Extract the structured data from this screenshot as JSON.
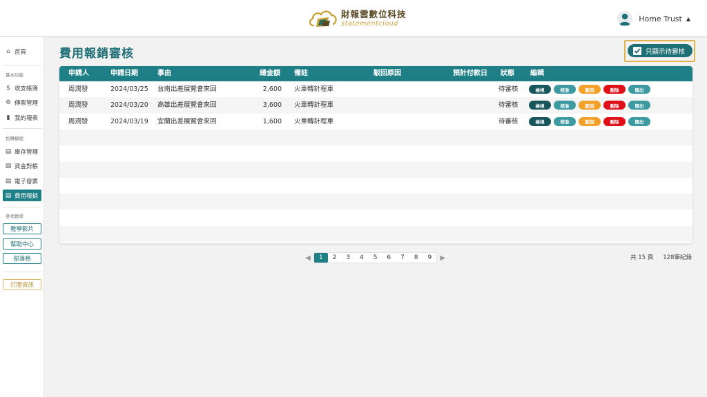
{
  "header": {
    "brand_cn": "財報雲數位科技",
    "brand_en": "statementcloud",
    "user_name": "Home Trust",
    "caret": "▲"
  },
  "sidebar": {
    "home": "首頁",
    "section_basic": "基本功能",
    "basic_items": [
      "收支帳簿",
      "傳票管理",
      "我的報表"
    ],
    "section_addon": "加購模組",
    "addon_items": [
      "庫存管理",
      "資金對帳",
      "電子發票",
      "費用報銷"
    ],
    "section_ref": "參考教學",
    "ref_buttons": [
      "教學影片",
      "幫助中心",
      "部落格"
    ],
    "subscribe": "訂閱資訊"
  },
  "page": {
    "title": "費用報銷審核",
    "filter_label": "只顯示待審核"
  },
  "table": {
    "headers": [
      "申請人",
      "申請日期",
      "事由",
      "總金額",
      "備註",
      "駁回原因",
      "預計付款日",
      "狀態",
      "編輯"
    ],
    "rows": [
      {
        "applicant": "周潤發",
        "date": "2024/03/25",
        "reason": "台南出差展覽會來回",
        "amount": "2,600",
        "note": "火車轉計程車",
        "reject_reason": "",
        "pay_date": "",
        "status": "待審核"
      },
      {
        "applicant": "周潤發",
        "date": "2024/03/20",
        "reason": "高雄出差展覽會來回",
        "amount": "3,600",
        "note": "火車轉計程車",
        "reject_reason": "",
        "pay_date": "",
        "status": "待審核"
      },
      {
        "applicant": "周潤發",
        "date": "2024/03/19",
        "reason": "宜蘭出差展覽會來回",
        "amount": "1,600",
        "note": "火車轉計程車",
        "reject_reason": "",
        "pay_date": "",
        "status": "待審核"
      }
    ],
    "action_labels": {
      "view": "檢視",
      "approve": "核准",
      "reject": "駁回",
      "delete": "刪除",
      "export": "匯出"
    }
  },
  "pagination": {
    "pages": [
      "1",
      "2",
      "3",
      "4",
      "5",
      "6",
      "7",
      "8",
      "9"
    ],
    "current": "1",
    "total_pages": "共 15 頁",
    "total_records": "128筆紀錄"
  },
  "colors": {
    "teal": "#1f7f86",
    "dark_teal": "#17565b",
    "orange": "#f2a12b",
    "red": "#e0101b",
    "gold": "#e0b44e"
  },
  "icons": {
    "home": "home-icon",
    "ledger": "dollar-circle-icon",
    "voucher": "gear-icon",
    "report": "bar-chart-icon",
    "module": "document-icon"
  }
}
